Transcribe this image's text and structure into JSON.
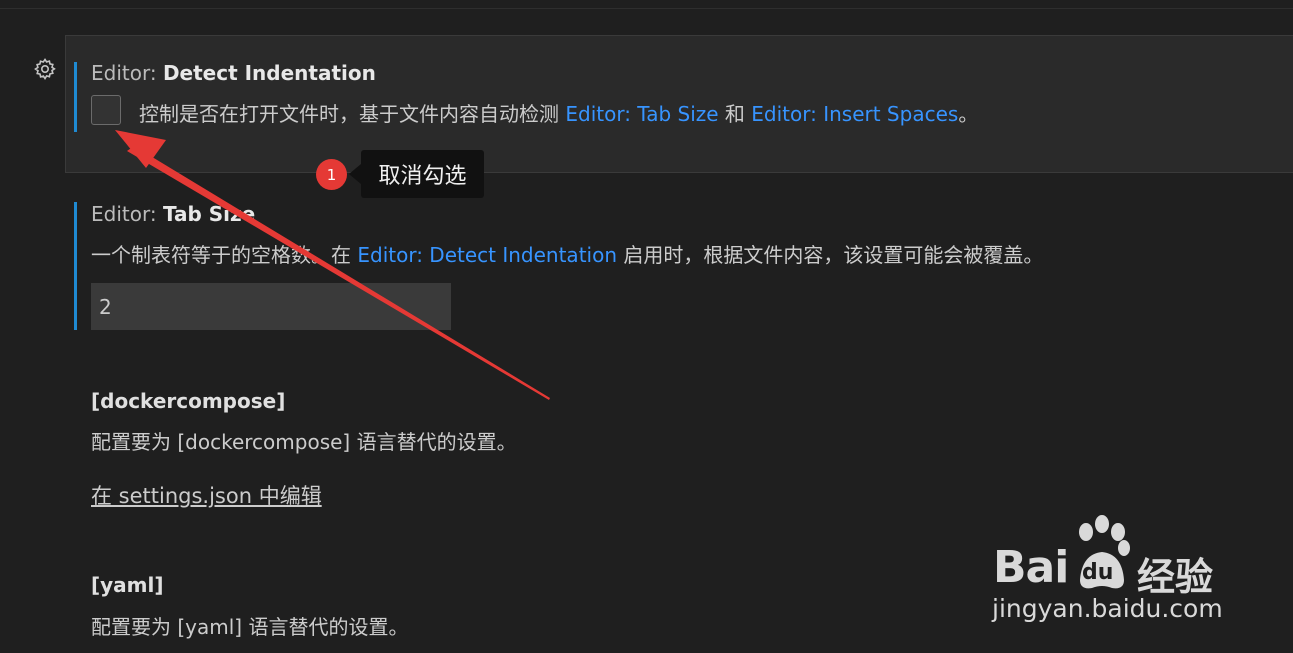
{
  "icons": {
    "settings": "gear-icon"
  },
  "detect_indentation": {
    "category": "Editor:",
    "name": "Detect Indentation",
    "description_prefix": "控制是否在打开文件时，基于文件内容自动检测",
    "link1": "Editor: Tab Size",
    "connector": "和",
    "link2": "Editor: Insert Spaces",
    "description_suffix": "。",
    "checked": false
  },
  "tab_size": {
    "category": "Editor:",
    "name": "Tab Size",
    "description_prefix": "一个制表符等于的空格数。在",
    "link": "Editor: Detect Indentation",
    "description_suffix": "启用时，根据文件内容，该设置可能会被覆盖。",
    "value": "2"
  },
  "dockercompose": {
    "title": "[dockercompose]",
    "description": "配置要为 [dockercompose] 语言替代的设置。",
    "edit_link": "在 settings.json 中编辑"
  },
  "yaml": {
    "title": "[yaml]",
    "description": "配置要为 [yaml] 语言替代的设置。"
  },
  "annotation": {
    "step": "1",
    "label": "取消勾选",
    "color": "#e53935"
  },
  "watermark": {
    "brand_left": "Bai",
    "brand_right": "du",
    "product": "经验",
    "url": "jingyan.baidu.com"
  }
}
